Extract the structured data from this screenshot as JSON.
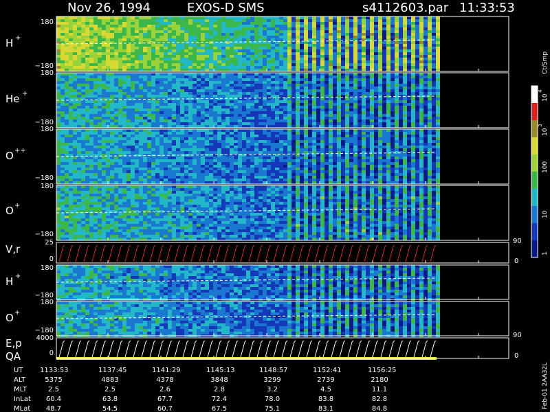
{
  "header": {
    "date": "Nov 26, 1994",
    "instrument": "EXOS-D SMS",
    "file": "s4112603.par",
    "time": "11:33:53"
  },
  "colors": {
    "background": "#000000",
    "fill": "#0a1a88",
    "axes": "#ffffff",
    "dash": "#ffffff"
  },
  "chart_data": {
    "type": "heatmap",
    "panels": [
      {
        "id": "h1",
        "label": "H",
        "sup": "+",
        "ymax": "180",
        "ymin": "−180"
      },
      {
        "id": "he",
        "label": "He",
        "sup": "+",
        "ymax": "180",
        "ymin": "−180"
      },
      {
        "id": "opp",
        "label": "O",
        "sup": "++",
        "ymax": "180",
        "ymin": "−180"
      },
      {
        "id": "op",
        "label": "O",
        "sup": "+",
        "ymax": "180",
        "ymin": "−180"
      },
      {
        "id": "vr",
        "label": "V,r",
        "ymax": "25",
        "ymin": "0",
        "rtop": "90",
        "rbot": "0"
      },
      {
        "id": "h2",
        "label": "H",
        "sup": "+",
        "ymax": "180",
        "ymin": "−180"
      },
      {
        "id": "o2",
        "label": "O",
        "sup": "+",
        "ymax": "180",
        "ymin": "−180"
      },
      {
        "id": "ep",
        "label": "E,p",
        "label2": "QA",
        "ymax": "4000",
        "ymin": "0",
        "rtop": "90",
        "rbot": "0"
      }
    ],
    "colorbar": {
      "unit": "Ct/Smp",
      "ticks": [
        "1",
        "10",
        "100",
        "10",
        "10"
      ],
      "sups": [
        "3",
        "4"
      ]
    },
    "ephemeris": {
      "rows": [
        {
          "label": "UT",
          "values": [
            "1133:53",
            "1137:45",
            "1141:29",
            "1145:13",
            "1148:57",
            "1152:41",
            "1156:25"
          ]
        },
        {
          "label": "ALT",
          "values": [
            "5375",
            "4883",
            "4378",
            "3848",
            "3299",
            "2739",
            "2180"
          ]
        },
        {
          "label": "MLT",
          "values": [
            "2.5",
            "2.5",
            "2.6",
            "2.8",
            "3.2",
            "4.5",
            "11.1"
          ]
        },
        {
          "label": "InLat",
          "values": [
            "60.4",
            "63.8",
            "67.7",
            "72.4",
            "78.0",
            "83.8",
            "82.8"
          ]
        },
        {
          "label": "MLat",
          "values": [
            "48.7",
            "54.5",
            "60.7",
            "67.5",
            "75.1",
            "83.1",
            "84.8"
          ]
        }
      ]
    },
    "footer": "Feb-01 2AA32L"
  }
}
